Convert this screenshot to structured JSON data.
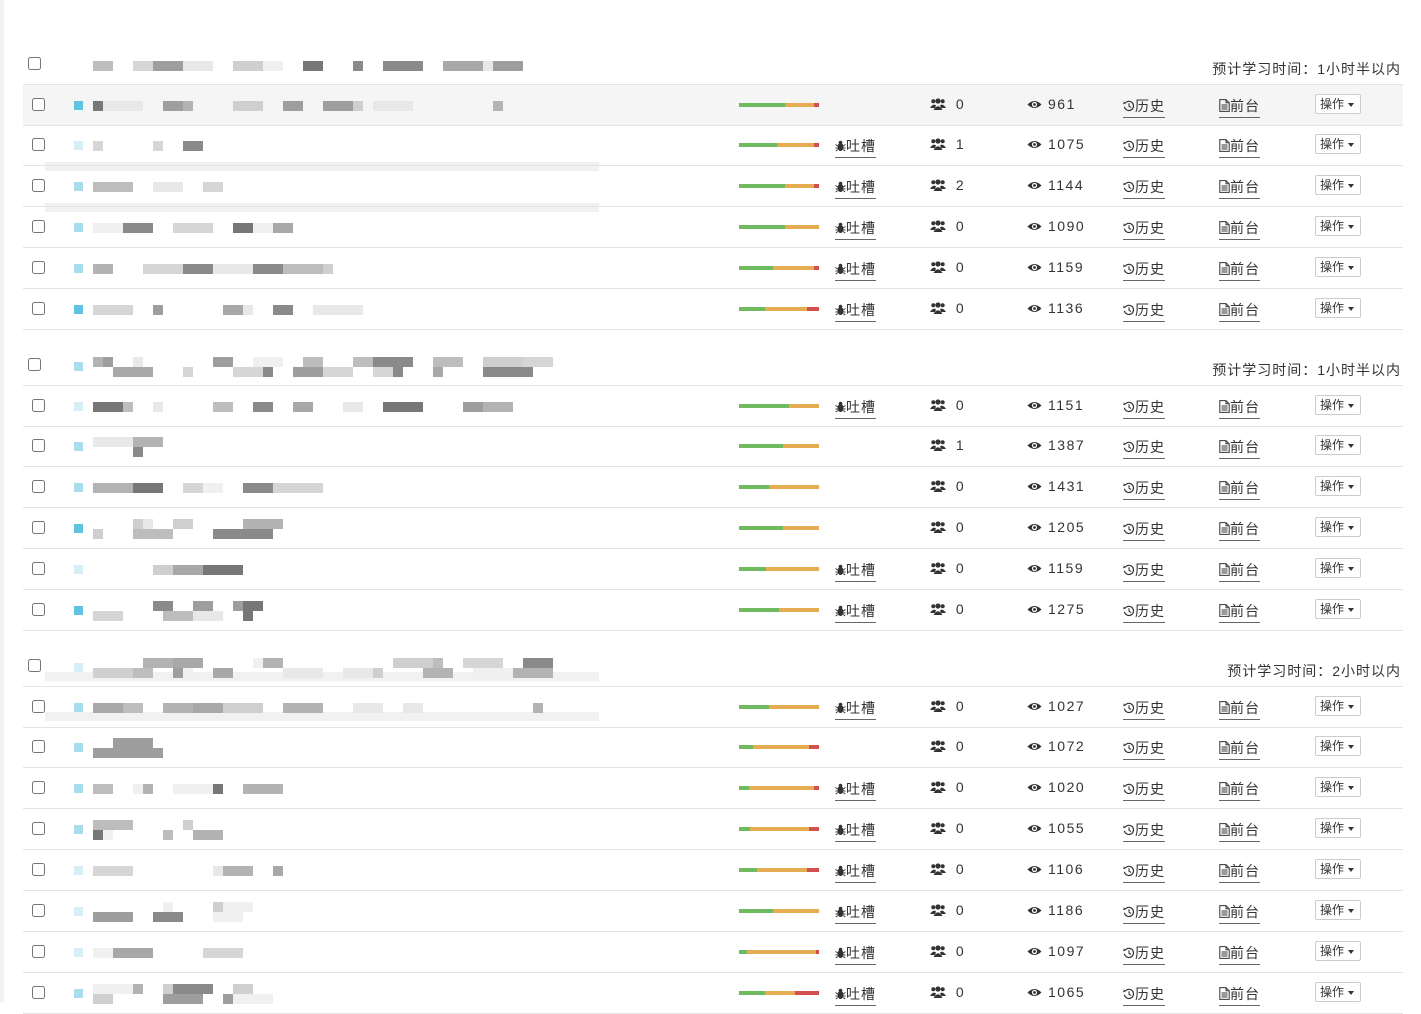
{
  "labels": {
    "complain": "吐槽",
    "history": "历史",
    "frontend": "前台",
    "operate": "操作"
  },
  "colors": {
    "progress_green": "#6fba5f",
    "progress_orange": "#e6ac52",
    "progress_red": "#d35050",
    "row_border": "#e4e4e4"
  },
  "icons": {
    "complain": "bug-icon",
    "users": "users-icon",
    "views": "eye-icon",
    "history": "history-icon",
    "frontend": "document-icon",
    "dropdown": "caret-down-icon"
  },
  "sections": [
    {
      "study_time": "预计学习时间：1小时半以内",
      "rows": [
        {
          "progress": [
            0.58,
            0.36,
            0.06
          ],
          "complain": false,
          "users": "0",
          "views": "961"
        },
        {
          "progress": [
            0.48,
            0.46,
            0.06
          ],
          "complain": true,
          "users": "1",
          "views": "1075"
        },
        {
          "progress": [
            0.58,
            0.36,
            0.06
          ],
          "complain": true,
          "users": "2",
          "views": "1144"
        },
        {
          "progress": [
            0.58,
            0.42,
            0.0
          ],
          "complain": true,
          "users": "0",
          "views": "1090"
        },
        {
          "progress": [
            0.42,
            0.52,
            0.06
          ],
          "complain": true,
          "users": "0",
          "views": "1159"
        },
        {
          "progress": [
            0.33,
            0.52,
            0.15
          ],
          "complain": true,
          "users": "0",
          "views": "1136"
        }
      ]
    },
    {
      "study_time": "预计学习时间：1小时半以内",
      "rows": [
        {
          "progress": [
            0.62,
            0.38,
            0.0
          ],
          "complain": true,
          "users": "0",
          "views": "1151"
        },
        {
          "progress": [
            0.55,
            0.45,
            0.0
          ],
          "complain": false,
          "users": "1",
          "views": "1387"
        },
        {
          "progress": [
            0.37,
            0.63,
            0.0
          ],
          "complain": false,
          "users": "0",
          "views": "1431"
        },
        {
          "progress": [
            0.55,
            0.45,
            0.0
          ],
          "complain": false,
          "users": "0",
          "views": "1205"
        },
        {
          "progress": [
            0.34,
            0.66,
            0.0
          ],
          "complain": true,
          "users": "0",
          "views": "1159"
        },
        {
          "progress": [
            0.5,
            0.5,
            0.0
          ],
          "complain": true,
          "users": "0",
          "views": "1275"
        }
      ]
    },
    {
      "study_time": "预计学习时间：2小时以内",
      "rows": [
        {
          "progress": [
            0.38,
            0.62,
            0.0
          ],
          "complain": true,
          "users": "0",
          "views": "1027"
        },
        {
          "progress": [
            0.18,
            0.7,
            0.12
          ],
          "complain": false,
          "users": "0",
          "views": "1072"
        },
        {
          "progress": [
            0.12,
            0.82,
            0.06
          ],
          "complain": true,
          "users": "0",
          "views": "1020"
        },
        {
          "progress": [
            0.14,
            0.73,
            0.13
          ],
          "complain": true,
          "users": "0",
          "views": "1055"
        },
        {
          "progress": [
            0.22,
            0.63,
            0.15
          ],
          "complain": true,
          "users": "0",
          "views": "1106"
        },
        {
          "progress": [
            0.43,
            0.57,
            0.0
          ],
          "complain": true,
          "users": "0",
          "views": "1186"
        },
        {
          "progress": [
            0.1,
            0.86,
            0.04
          ],
          "complain": true,
          "users": "0",
          "views": "1097"
        },
        {
          "progress": [
            0.33,
            0.37,
            0.3
          ],
          "complain": true,
          "users": "0",
          "views": "1065"
        }
      ]
    }
  ]
}
